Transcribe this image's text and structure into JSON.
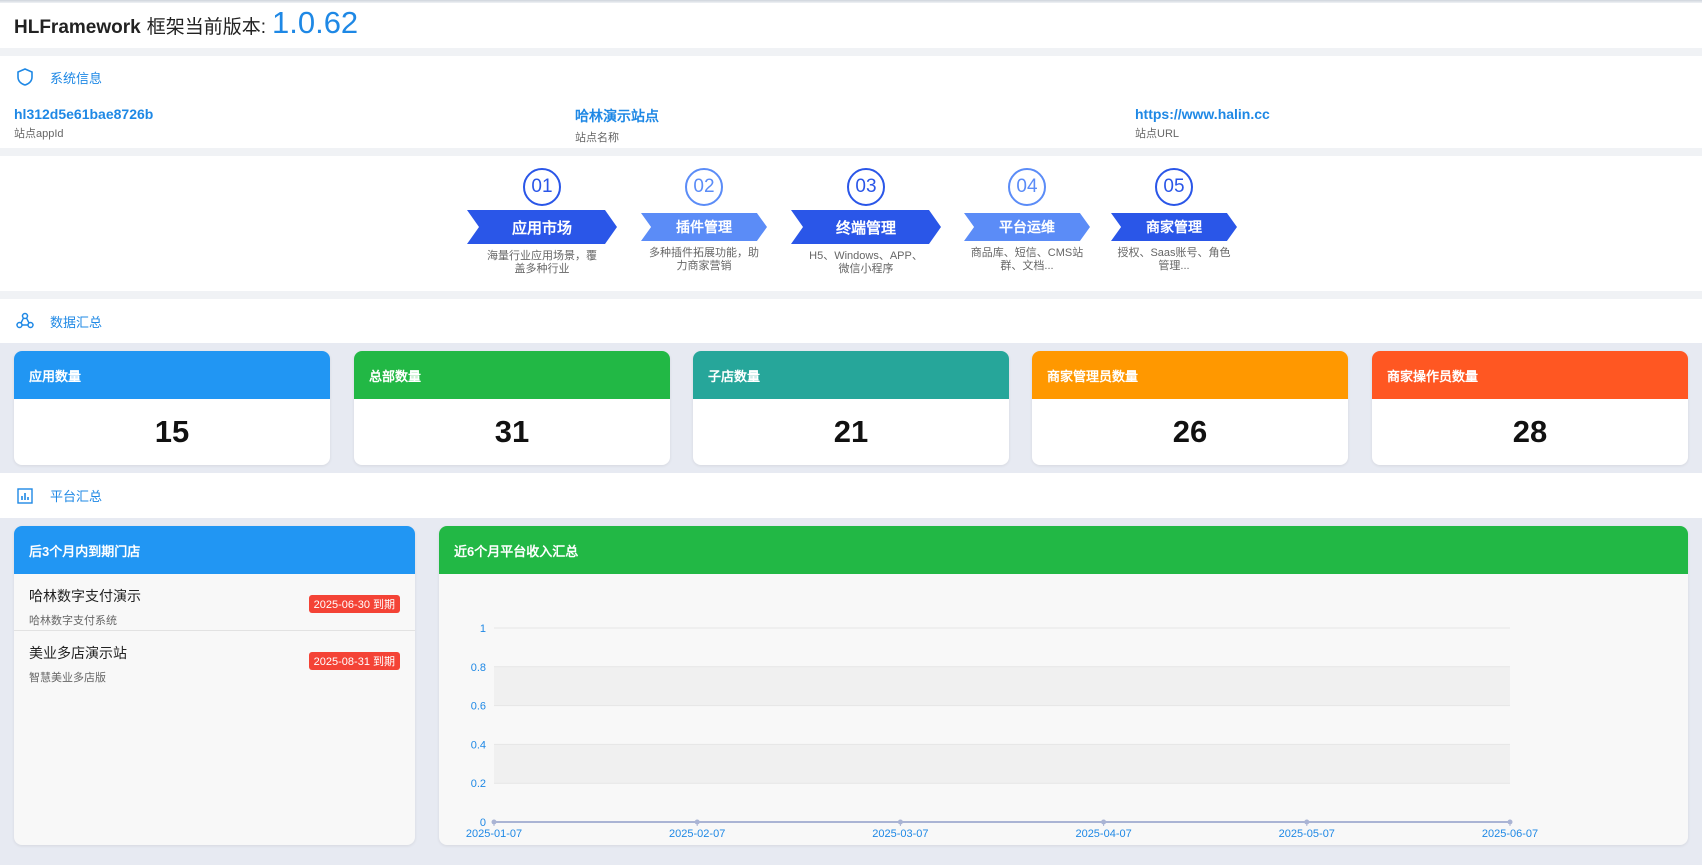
{
  "header": {
    "prefix": "HLFramework",
    "label": "框架当前版本:",
    "version": "1.0.62"
  },
  "system_info": {
    "title": "系统信息",
    "items": [
      {
        "value": "hl312d5e61bae8726b",
        "label": "站点appId"
      },
      {
        "value": "哈林演示站点",
        "label": "站点名称"
      },
      {
        "value": "https://www.halin.cc",
        "label": "站点URL"
      }
    ]
  },
  "steps": [
    {
      "num": "01",
      "title": "应用市场",
      "desc": "海量行业应用场景，覆盖多种行业"
    },
    {
      "num": "02",
      "title": "插件管理",
      "desc": "多种插件拓展功能，助力商家营销"
    },
    {
      "num": "03",
      "title": "终端管理",
      "desc": "H5、Windows、APP、微信小程序"
    },
    {
      "num": "04",
      "title": "平台运维",
      "desc": "商品库、短信、CMS站群、文档..."
    },
    {
      "num": "05",
      "title": "商家管理",
      "desc": "授权、Saas账号、角色管理..."
    }
  ],
  "data_summary": {
    "title": "数据汇总",
    "cards": [
      {
        "label": "应用数量",
        "value": "15",
        "color": "#2196f3"
      },
      {
        "label": "总部数量",
        "value": "31",
        "color": "#22b845"
      },
      {
        "label": "子店数量",
        "value": "21",
        "color": "#26a69a"
      },
      {
        "label": "商家管理员数量",
        "value": "26",
        "color": "#ff9800"
      },
      {
        "label": "商家操作员数量",
        "value": "28",
        "color": "#ff5722"
      }
    ]
  },
  "platform_summary": {
    "title": "平台汇总"
  },
  "expiring": {
    "title": "后3个月内到期门店",
    "stores": [
      {
        "name": "哈林数字支付演示",
        "sub": "哈林数字支付系统",
        "badge": "2025-06-30 到期"
      },
      {
        "name": "美业多店演示站",
        "sub": "智慧美业多店版",
        "badge": "2025-08-31 到期"
      }
    ]
  },
  "revenue": {
    "title": "近6个月平台收入汇总",
    "chart_data": {
      "type": "line",
      "x": [
        "2025-01-07",
        "2025-02-07",
        "2025-03-07",
        "2025-04-07",
        "2025-05-07",
        "2025-06-07"
      ],
      "series": [
        {
          "values": [
            0,
            0,
            0,
            0,
            0,
            0
          ]
        }
      ],
      "ylim": [
        0,
        1
      ],
      "yticks": [
        "0",
        "0.2",
        "0.4",
        "0.6",
        "0.8",
        "1"
      ],
      "grid": true
    }
  },
  "colors": {
    "accent": "#1e88e5",
    "step_dark": "#2a56e8",
    "step_light": "#5b8cf7",
    "badge": "#f44336"
  }
}
